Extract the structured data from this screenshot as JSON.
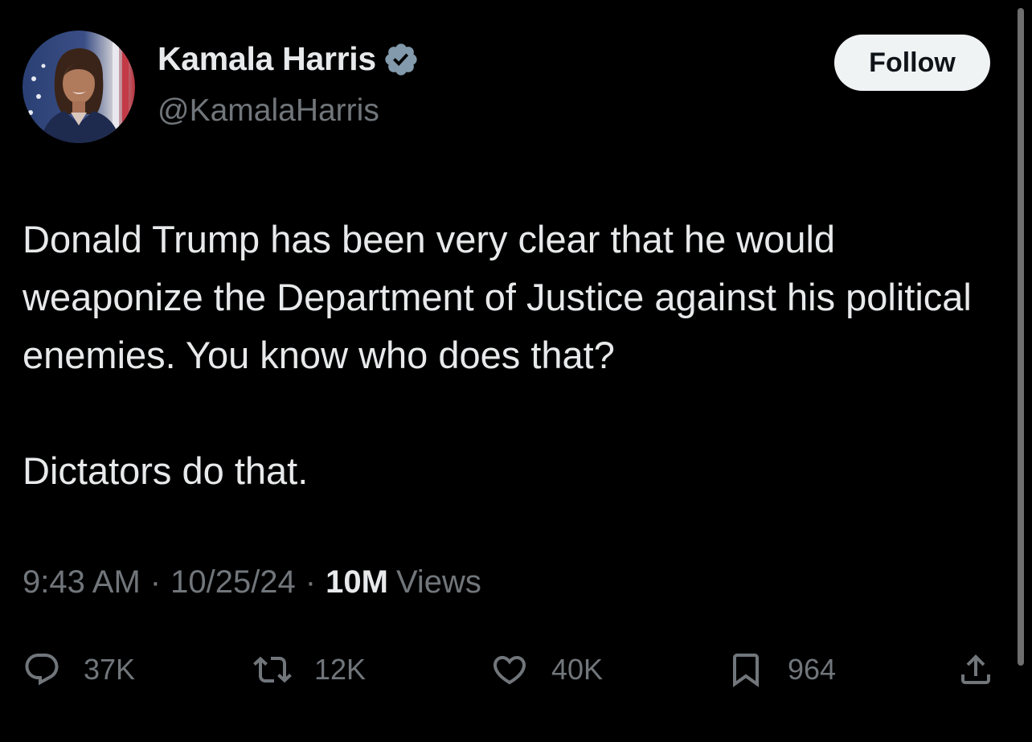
{
  "user": {
    "display_name": "Kamala Harris",
    "handle": "@KamalaHarris",
    "verified": true
  },
  "follow_label": "Follow",
  "tweet": {
    "paragraph_1": "Donald Trump has been very clear that he would weaponize the Department of Justice against his political enemies. You know who does that?",
    "paragraph_2": "Dictators do that."
  },
  "meta": {
    "time": "9:43 AM",
    "separator": "·",
    "date": "10/25/24",
    "views_count": "10M",
    "views_label": "Views"
  },
  "actions": {
    "reply": {
      "icon": "reply-icon",
      "count": "37K"
    },
    "retweet": {
      "icon": "retweet-icon",
      "count": "12K"
    },
    "like": {
      "icon": "heart-icon",
      "count": "40K"
    },
    "bookmark": {
      "icon": "bookmark-icon",
      "count": "964"
    },
    "share": {
      "icon": "share-icon"
    }
  },
  "colors": {
    "background": "#000000",
    "primary_text": "#e7e9ea",
    "secondary_text": "#71767b",
    "verified_badge": "#829aab",
    "follow_button_bg": "#eff3f4",
    "follow_button_text": "#0f1419"
  }
}
